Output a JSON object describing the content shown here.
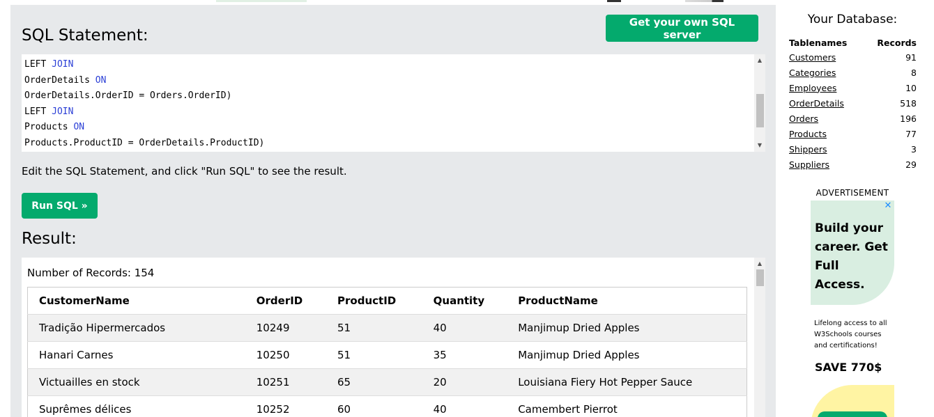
{
  "main": {
    "sql_heading": "SQL Statement:",
    "get_server_label": "Get your own SQL server",
    "code_lines": [
      [
        {
          "t": "LEFT "
        },
        {
          "t": "JOIN",
          "kw": true
        }
      ],
      [
        {
          "t": "OrderDetails "
        },
        {
          "t": "ON",
          "kw": true
        }
      ],
      [
        {
          "t": "OrderDetails.OrderID = Orders.OrderID)"
        }
      ],
      [
        {
          "t": "LEFT "
        },
        {
          "t": "JOIN",
          "kw": true
        }
      ],
      [
        {
          "t": "Products "
        },
        {
          "t": "ON",
          "kw": true
        }
      ],
      [
        {
          "t": "Products.ProductID = OrderDetails.ProductID)"
        }
      ]
    ],
    "instructions": "Edit the SQL Statement, and click \"Run SQL\" to see the result.",
    "run_label": "Run SQL »",
    "result_heading": "Result:",
    "record_count": "Number of Records: 154",
    "columns": [
      "CustomerName",
      "OrderID",
      "ProductID",
      "Quantity",
      "ProductName"
    ],
    "rows": [
      [
        "Tradição Hipermercados",
        "10249",
        "51",
        "40",
        "Manjimup Dried Apples"
      ],
      [
        "Hanari Carnes",
        "10250",
        "51",
        "35",
        "Manjimup Dried Apples"
      ],
      [
        "Victuailles en stock",
        "10251",
        "65",
        "20",
        "Louisiana Fiery Hot Pepper Sauce"
      ],
      [
        "Suprêmes délices",
        "10252",
        "60",
        "40",
        "Camembert Pierrot"
      ]
    ]
  },
  "sidebar": {
    "title": "Your Database:",
    "col_tables": "Tablenames",
    "col_records": "Records",
    "tables": [
      {
        "name": "Customers",
        "records": "91"
      },
      {
        "name": "Categories",
        "records": "8"
      },
      {
        "name": "Employees",
        "records": "10"
      },
      {
        "name": "OrderDetails",
        "records": "518"
      },
      {
        "name": "Orders",
        "records": "196"
      },
      {
        "name": "Products",
        "records": "77"
      },
      {
        "name": "Shippers",
        "records": "3"
      },
      {
        "name": "Suppliers",
        "records": "29"
      }
    ]
  },
  "ad": {
    "label": "ADVERTISEMENT",
    "close_glyph": "✕",
    "headline": "Build your career. Get Full Access.",
    "body": "Lifelong access to all W3Schools courses and certifications!",
    "save": "SAVE 770$"
  },
  "colors": {
    "accent": "#04aa6d",
    "panel": "#e7e9eb",
    "keyword": "#2b3fd6"
  },
  "scroll": {
    "code_thumb_fraction": 0.4,
    "result_thumb_fraction": 0.0
  }
}
